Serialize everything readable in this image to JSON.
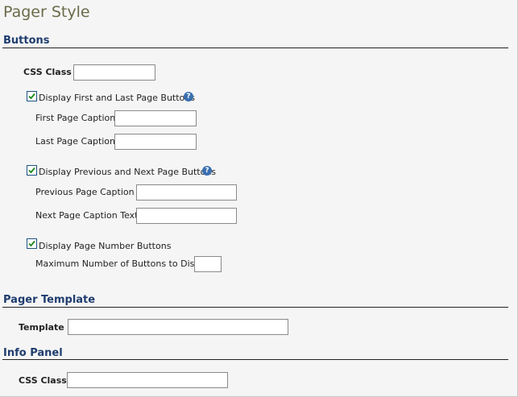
{
  "page": {
    "title": "Pager Style"
  },
  "buttons_section": {
    "heading": "Buttons",
    "css_class": {
      "label": "CSS Class",
      "value": ""
    },
    "first_last": {
      "checkbox_label": "Display First and Last Page Buttons",
      "checked": true,
      "first_caption": {
        "label": "First Page Caption",
        "value": ""
      },
      "last_caption": {
        "label": "Last Page Caption",
        "value": ""
      }
    },
    "prev_next": {
      "checkbox_label": "Display Previous and Next Page Buttons",
      "checked": true,
      "prev_caption": {
        "label": "Previous Page Caption",
        "value": ""
      },
      "next_caption": {
        "label": "Next Page Caption Text",
        "value": ""
      }
    },
    "page_numbers": {
      "checkbox_label": "Display Page Number Buttons",
      "checked": true,
      "max_buttons": {
        "label": "Maximum Number of Buttons to Display",
        "value": ""
      }
    }
  },
  "template_section": {
    "heading": "Pager Template",
    "template": {
      "label": "Template",
      "value": ""
    }
  },
  "info_section": {
    "heading": "Info Panel",
    "css_class": {
      "label": "CSS Class",
      "value": ""
    }
  },
  "colors": {
    "title": "#6b6b4a",
    "heading": "#1f3d6e",
    "background": "#f5f5f5",
    "help_icon": "#3a6fb0"
  },
  "icons": {
    "help": "help-icon",
    "check": "check-icon"
  }
}
